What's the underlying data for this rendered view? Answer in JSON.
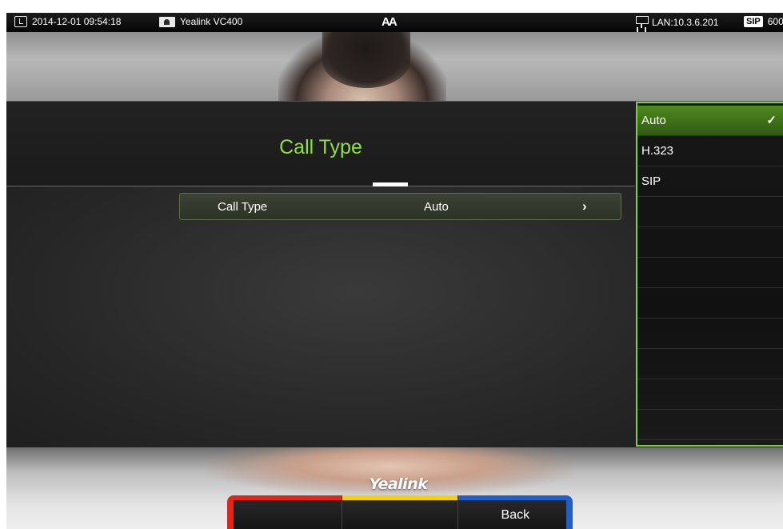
{
  "status_bar": {
    "datetime": "2014-12-01 09:54:18",
    "device_name": "Yealink VC400",
    "font_toggle": "AA",
    "network": "LAN:10.3.6.201",
    "sip_badge": "SIP",
    "sip_account": "600"
  },
  "page": {
    "title": "Call Type"
  },
  "setting": {
    "label": "Call Type",
    "value": "Auto",
    "chevron": "›"
  },
  "options": [
    {
      "label": "Auto",
      "selected": true,
      "check": "✓"
    },
    {
      "label": "H.323",
      "selected": false
    },
    {
      "label": "SIP",
      "selected": false
    }
  ],
  "softkeys": [
    {
      "label": "",
      "color": "#e1251b"
    },
    {
      "label": "",
      "color": "#f5d100"
    },
    {
      "label": "Back",
      "color": "#1f5fc9"
    }
  ],
  "brand": "Yealink",
  "colors": {
    "accent_green": "#8fe03a",
    "list_border": "#7fd13a",
    "selected_bg": "#3f7a18"
  }
}
